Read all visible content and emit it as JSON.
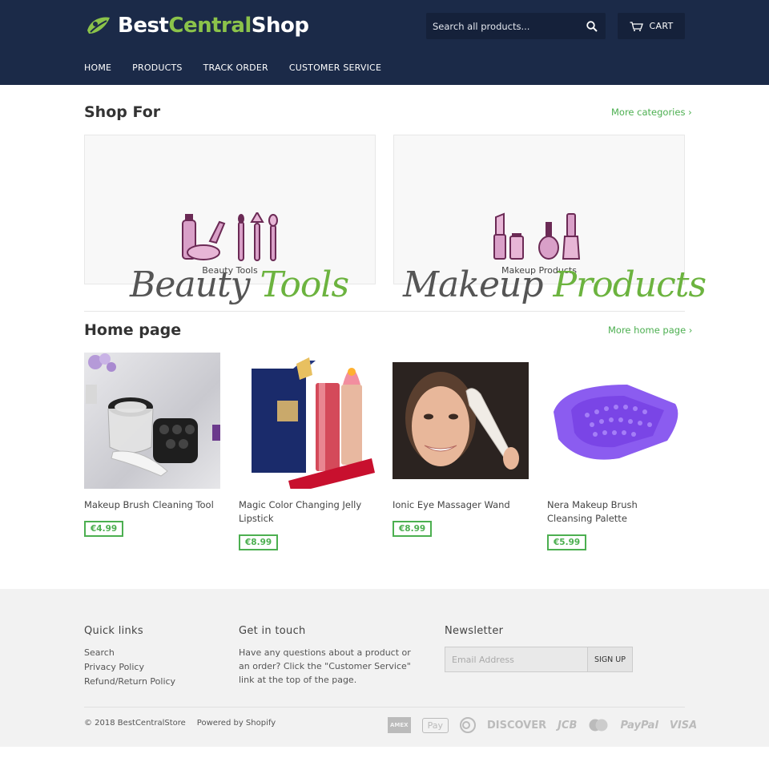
{
  "header": {
    "logo": {
      "part1": "Best",
      "part2": "Central",
      "part3": "Shop"
    },
    "search": {
      "placeholder": "Search all products..."
    },
    "cart_label": "CART",
    "nav": [
      "HOME",
      "PRODUCTS",
      "TRACK ORDER",
      "CUSTOMER SERVICE"
    ]
  },
  "shop_for": {
    "title": "Shop For",
    "more_link": "More categories ›",
    "collections": [
      {
        "label": "Beauty Tools",
        "script_dark": "Beauty",
        "script_green": "Tools"
      },
      {
        "label": "Makeup Products",
        "script_dark": "Makeup",
        "script_green": "Products"
      }
    ]
  },
  "home_page": {
    "title": "Home page",
    "more_link": "More home page ›",
    "products": [
      {
        "title": "Makeup Brush Cleaning Tool",
        "price": "€4.99"
      },
      {
        "title": "Magic Color Changing Jelly Lipstick",
        "price": "€8.99"
      },
      {
        "title": "Ionic Eye Massager Wand",
        "price": "€8.99"
      },
      {
        "title": "Nera Makeup Brush Cleansing Palette",
        "price": "€5.99"
      }
    ]
  },
  "footer": {
    "quick_links": {
      "title": "Quick links",
      "items": [
        "Search",
        "Privacy Policy",
        "Refund/Return Policy"
      ]
    },
    "get_in_touch": {
      "title": "Get in touch",
      "text": "Have any questions about a product or an order? Click the \"Customer Service\" link at the top of the page."
    },
    "newsletter": {
      "title": "Newsletter",
      "placeholder": "Email Address",
      "button": "SIGN UP"
    },
    "copyright": "© 2018 BestCentralStore",
    "powered_by": "Powered by Shopify",
    "payments": [
      "AMEX",
      "Pay",
      "Diners",
      "DISCOVER",
      "JCB",
      "MasterCard",
      "PayPal",
      "VISA"
    ]
  },
  "colors": {
    "header_bg": "#1b2a48",
    "accent_green": "#4caf50",
    "footer_bg": "#f2f2f2"
  }
}
